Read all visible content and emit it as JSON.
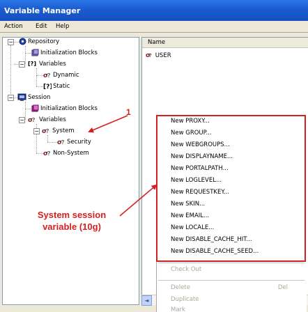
{
  "window": {
    "title": "Variable Manager"
  },
  "menubar": {
    "items": [
      "Action",
      "Edit",
      "Help"
    ]
  },
  "tree": {
    "repository": {
      "label": "Repository",
      "expander": "−",
      "init_blocks": "Initialization Blocks",
      "variables": {
        "label": "Variables",
        "expander": "−",
        "icon_text": "[?]",
        "children": [
          "Dynamic",
          "Static"
        ]
      }
    },
    "session": {
      "label": "Session",
      "expander": "−",
      "init_blocks": "Initialization Blocks",
      "variables": {
        "label": "Variables",
        "expander": "−",
        "system": {
          "label": "System",
          "expander": "−",
          "children": [
            "Security"
          ]
        },
        "non_system": "Non-System"
      }
    }
  },
  "list": {
    "column_header": "Name",
    "rows": [
      "USER"
    ]
  },
  "context_menu": {
    "new_items": [
      "New PROXY...",
      "New GROUP...",
      "New WEBGROUPS...",
      "New DISPLAYNAME...",
      "New PORTALPATH...",
      "New LOGLEVEL...",
      "New REQUESTKEY...",
      "New SKIN...",
      "New EMAIL...",
      "New LOCALE...",
      "New DISABLE_CACHE_HIT...",
      "New DISABLE_CACHE_SEED..."
    ],
    "check_out": "Check Out",
    "delete": "Delete",
    "delete_shortcut": "Del",
    "duplicate": "Duplicate",
    "mark": "Mark"
  },
  "annotations": {
    "number": "1",
    "callout": "System session variable (10g)",
    "color": "#d41f1f"
  },
  "scrollbar": {
    "left_arrow": "◄"
  }
}
